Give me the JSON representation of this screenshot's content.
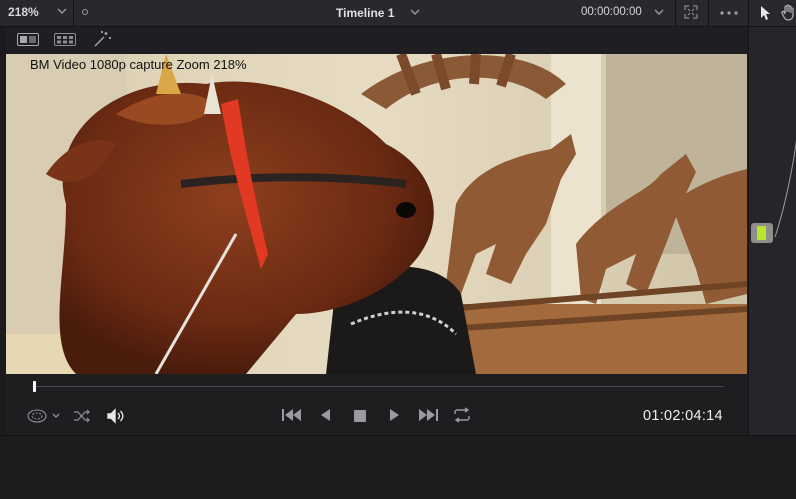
{
  "header": {
    "zoom_level": "218%",
    "timeline_title": "Timeline 1",
    "timecode": "00:00:00:00"
  },
  "viewer": {
    "overlay_text": "BM Video 1080p capture Zoom 218%",
    "playhead_position": 0.003
  },
  "transport": {
    "timecode": "01:02:04:14"
  },
  "icons": {
    "zoom_dropdown": "chevron-down-icon",
    "timeline_dropdown": "chevron-down-icon",
    "timecode_dropdown": "chevron-down-icon",
    "fullscreen": "expand-icon",
    "more": "more-icon",
    "pointer": "pointer-icon",
    "hand": "hand-icon",
    "single_view": "single-viewer-icon",
    "grid_view": "grid-viewer-icon",
    "magic": "magic-wand-icon",
    "clip_mode": "clip-mode-icon",
    "shuffle": "shuffle-icon",
    "volume": "volume-icon",
    "prev": "skip-back-icon",
    "reverse": "play-reverse-icon",
    "stop": "stop-icon",
    "play": "play-icon",
    "next": "skip-forward-icon",
    "loop": "loop-icon"
  },
  "colors": {
    "node_accent": "#b7e62a"
  }
}
